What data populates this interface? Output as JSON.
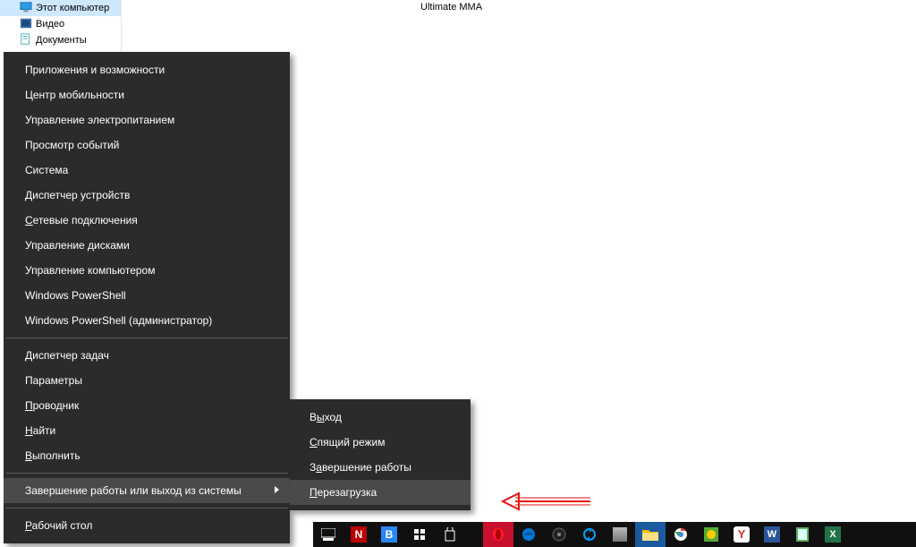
{
  "explorer": {
    "selected": "Этот компьютер",
    "tree": [
      {
        "label": "Этот компьютер"
      },
      {
        "label": "Видео"
      },
      {
        "label": "Документы"
      }
    ],
    "folder_name": "Ultimate MMA"
  },
  "winx_menu": {
    "group1": [
      "Приложения и возможности",
      "Центр мобильности",
      "Управление электропитанием",
      "Просмотр событий",
      "Система",
      "Диспетчер устройств",
      "Сетевые подключения",
      "Управление дисками",
      "Управление компьютером",
      "Windows PowerShell",
      "Windows PowerShell (администратор)"
    ],
    "group2": [
      "Диспетчер задач",
      "Параметры",
      "Проводник",
      "Найти",
      "Выполнить"
    ],
    "shutdown_label": "Завершение работы или выход из системы",
    "desktop_label": "Рабочий стол"
  },
  "shutdown_submenu": [
    "Выход",
    "Спящий режим",
    "Завершение работы",
    "Перезагрузка"
  ],
  "submenu_hover_index": 3,
  "taskbar_icons": [
    {
      "name": "task-view-icon",
      "color": "#ffffff"
    },
    {
      "name": "netflix-icon",
      "color": "#e50914"
    },
    {
      "name": "vk-icon",
      "color": "#2787f5"
    },
    {
      "name": "store-icon",
      "color": "#ffffff"
    },
    {
      "name": "shopping-bag-icon",
      "color": "#ffffff"
    },
    {
      "name": "opera-icon",
      "color": "#ff1b2d"
    },
    {
      "name": "edge-icon",
      "color": "#0078d7"
    },
    {
      "name": "media-player-icon",
      "color": "#222"
    },
    {
      "name": "sync-icon",
      "color": "#00a2ff"
    },
    {
      "name": "app-icon",
      "color": "#888"
    },
    {
      "name": "explorer-icon",
      "color": "#ffb900"
    },
    {
      "name": "chrome-icon",
      "color": "#ffffff"
    },
    {
      "name": "yandex-icon",
      "color": "#ffcc00"
    },
    {
      "name": "yandex-y-icon",
      "color": "#d93025"
    },
    {
      "name": "word-icon",
      "color": "#2b579a"
    },
    {
      "name": "notepad-icon",
      "color": "#5fb05f"
    },
    {
      "name": "excel-icon",
      "color": "#217346"
    }
  ]
}
